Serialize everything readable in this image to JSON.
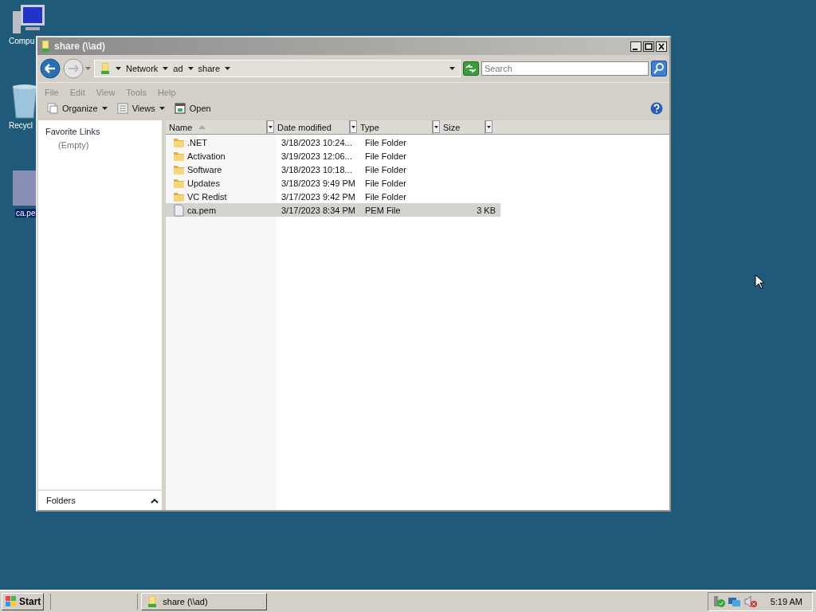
{
  "desktop": {
    "icons": [
      {
        "label": "Compu",
        "kind": "computer"
      },
      {
        "label": "Recycl",
        "kind": "recycle"
      },
      {
        "label": "ca.pe",
        "kind": "file",
        "selected": true
      }
    ]
  },
  "window": {
    "title": "share (\\\\ad)",
    "breadcrumb": [
      "Network",
      "ad",
      "share"
    ],
    "search": {
      "placeholder": "Search"
    },
    "menu": [
      "File",
      "Edit",
      "View",
      "Tools",
      "Help"
    ],
    "toolbar": [
      {
        "label": "Organize",
        "kind": "organize"
      },
      {
        "label": "Views",
        "kind": "views"
      },
      {
        "label": "Open",
        "kind": "open"
      }
    ],
    "nav": {
      "heading": "Favorite Links",
      "items": [
        "(Empty)"
      ],
      "folders": "Folders"
    },
    "table": {
      "columns": [
        {
          "label": "Name",
          "sorted": true
        },
        {
          "label": "Date modified",
          "sorted": false
        },
        {
          "label": "Type",
          "sorted": false
        },
        {
          "label": "Size",
          "sorted": false
        }
      ],
      "rows": [
        {
          "kind": "folder",
          "selected": false,
          "cells": [
            ".NET",
            "3/18/2023 10:24...",
            "File Folder",
            ""
          ]
        },
        {
          "kind": "folder",
          "selected": false,
          "cells": [
            "Activation",
            "3/19/2023 12:06...",
            "File Folder",
            ""
          ]
        },
        {
          "kind": "folder",
          "selected": false,
          "cells": [
            "Software",
            "3/18/2023 10:18...",
            "File Folder",
            ""
          ]
        },
        {
          "kind": "folder",
          "selected": false,
          "cells": [
            "Updates",
            "3/18/2023 9:49 PM",
            "File Folder",
            ""
          ]
        },
        {
          "kind": "folder",
          "selected": false,
          "cells": [
            "VC Redist",
            "3/17/2023 9:42 PM",
            "File Folder",
            ""
          ]
        },
        {
          "kind": "file",
          "selected": true,
          "cells": [
            "ca.pem",
            "3/17/2023 8:34 PM",
            "PEM File",
            "3 KB"
          ]
        }
      ]
    }
  },
  "taskbar": {
    "start": "Start",
    "tasks": [
      {
        "label": "share (\\\\ad)"
      }
    ],
    "clock": "5:19 AM"
  }
}
